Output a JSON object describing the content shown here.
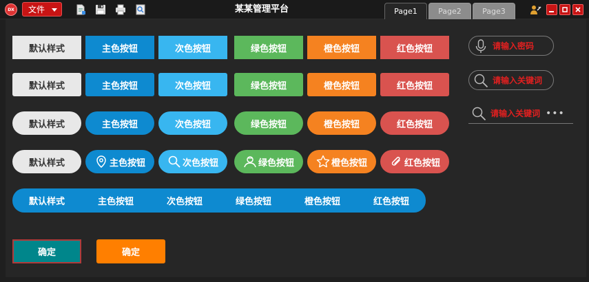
{
  "titlebar": {
    "logo_text": "DX",
    "file_menu_label": "文件",
    "window_title": "某某管理平台",
    "tabs": [
      {
        "label": "Page1",
        "active": true
      },
      {
        "label": "Page2",
        "active": false
      },
      {
        "label": "Page3",
        "active": false
      }
    ],
    "toolbar_icons": [
      "new-file-icon",
      "save-icon",
      "print-icon",
      "preview-icon"
    ],
    "window_controls": [
      "minimize-icon",
      "maximize-icon",
      "close-icon"
    ]
  },
  "button_rows": {
    "labels": [
      "默认样式",
      "主色按钮",
      "次色按钮",
      "绿色按钮",
      "橙色按钮",
      "红色按钮"
    ],
    "icon_row": [
      {
        "label": "默认样式",
        "icon": null
      },
      {
        "label": "主色按钮",
        "icon": "location-pin-icon"
      },
      {
        "label": "次色按钮",
        "icon": "search-icon"
      },
      {
        "label": "绿色按钮",
        "icon": "user-icon"
      },
      {
        "label": "橙色按钮",
        "icon": "star-icon"
      },
      {
        "label": "红色按钮",
        "icon": "paperclip-icon"
      }
    ]
  },
  "segmented": {
    "items": [
      "默认样式",
      "主色按钮",
      "次色按钮",
      "绿色按钮",
      "橙色按钮",
      "红色按钮"
    ]
  },
  "confirm_buttons": {
    "teal_label": "确定",
    "orange_label": "确定"
  },
  "search_fields": {
    "password_placeholder": "请输入密码",
    "keyword_placeholder": "请输入关键词",
    "keyword2_placeholder": "请输入关键词",
    "more_label": "•••"
  },
  "colors": {
    "default": "#e8e8e8",
    "primary": "#0e8ad0",
    "secondary": "#38b6f0",
    "green": "#5cb85c",
    "orange": "#f58220",
    "red": "#d9534f",
    "teal": "#00868b",
    "title_red": "#c81414",
    "placeholder_red": "#e02020"
  }
}
